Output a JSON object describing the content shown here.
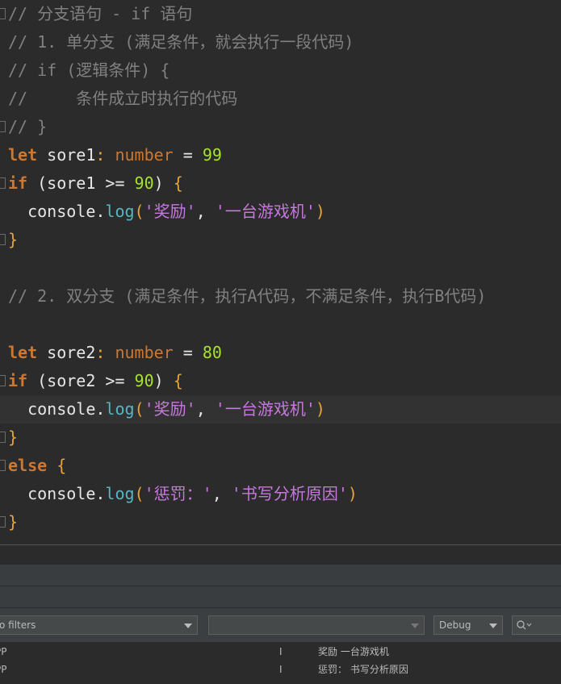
{
  "editor": {
    "lines": [
      {
        "segments": [
          {
            "c": "comment",
            "t": "// 分支语句 - if 语句"
          }
        ]
      },
      {
        "segments": [
          {
            "c": "comment",
            "t": "// 1. 单分支 (满足条件，就会执行一段代码)"
          }
        ]
      },
      {
        "segments": [
          {
            "c": "comment",
            "t": "// if (逻辑条件) {"
          }
        ]
      },
      {
        "segments": [
          {
            "c": "comment",
            "t": "//     条件成立时执行的代码"
          }
        ]
      },
      {
        "segments": [
          {
            "c": "comment",
            "t": "// }"
          }
        ]
      },
      {
        "segments": [
          {
            "c": "kw",
            "t": "let"
          },
          {
            "c": "plain",
            "t": " sore1"
          },
          {
            "c": "brace",
            "t": ": "
          },
          {
            "c": "type",
            "t": "number"
          },
          {
            "c": "plain",
            "t": " = "
          },
          {
            "c": "num",
            "t": "99"
          }
        ]
      },
      {
        "segments": [
          {
            "c": "kw",
            "t": "if"
          },
          {
            "c": "plain",
            "t": " (sore1 >= "
          },
          {
            "c": "num",
            "t": "90"
          },
          {
            "c": "plain",
            "t": ") "
          },
          {
            "c": "brace",
            "t": "{"
          }
        ]
      },
      {
        "segments": [
          {
            "c": "plain",
            "t": "  console."
          },
          {
            "c": "fn",
            "t": "log"
          },
          {
            "c": "brace",
            "t": "("
          },
          {
            "c": "str",
            "t": "'奖励'"
          },
          {
            "c": "plain",
            "t": ", "
          },
          {
            "c": "str",
            "t": "'一台游戏机'"
          },
          {
            "c": "brace",
            "t": ")"
          }
        ]
      },
      {
        "segments": [
          {
            "c": "brace",
            "t": "}"
          }
        ]
      },
      {
        "segments": []
      },
      {
        "segments": [
          {
            "c": "comment",
            "t": "// 2. 双分支 (满足条件，执行A代码，不满足条件，执行B代码)"
          }
        ]
      },
      {
        "segments": []
      },
      {
        "segments": [
          {
            "c": "kw",
            "t": "let"
          },
          {
            "c": "plain",
            "t": " sore2"
          },
          {
            "c": "brace",
            "t": ": "
          },
          {
            "c": "type",
            "t": "number"
          },
          {
            "c": "plain",
            "t": " = "
          },
          {
            "c": "num",
            "t": "80"
          }
        ]
      },
      {
        "segments": [
          {
            "c": "kw",
            "t": "if"
          },
          {
            "c": "plain",
            "t": " (sore2 >= "
          },
          {
            "c": "num",
            "t": "90"
          },
          {
            "c": "plain",
            "t": ") "
          },
          {
            "c": "brace",
            "t": "{"
          }
        ]
      },
      {
        "segments": [
          {
            "c": "plain",
            "t": "  console."
          },
          {
            "c": "fn",
            "t": "log"
          },
          {
            "c": "brace",
            "t": "("
          },
          {
            "c": "str",
            "t": "'奖励'"
          },
          {
            "c": "plain",
            "t": ", "
          },
          {
            "c": "str",
            "t": "'一台游戏机'"
          },
          {
            "c": "brace",
            "t": ")"
          }
        ]
      },
      {
        "segments": [
          {
            "c": "brace",
            "t": "}"
          }
        ]
      },
      {
        "segments": [
          {
            "c": "kw",
            "t": "else"
          },
          {
            "c": "plain",
            "t": " "
          },
          {
            "c": "brace",
            "t": "{"
          }
        ]
      },
      {
        "segments": [
          {
            "c": "plain",
            "t": "  console."
          },
          {
            "c": "fn",
            "t": "log"
          },
          {
            "c": "brace",
            "t": "("
          },
          {
            "c": "str",
            "t": "'惩罚：'"
          },
          {
            "c": "plain",
            "t": ", "
          },
          {
            "c": "str",
            "t": "'书写分析原因'"
          },
          {
            "c": "brace",
            "t": ")"
          }
        ]
      },
      {
        "segments": [
          {
            "c": "brace",
            "t": "}"
          }
        ]
      }
    ],
    "current_line": 14,
    "fold_markers_on": [
      0,
      4,
      6,
      8,
      13,
      15,
      16,
      18
    ]
  },
  "console": {
    "filter_combo": "o filters",
    "second_combo": "",
    "level_combo": "Debug",
    "search_icon": "search-icon",
    "rows": [
      {
        "tag": "PP",
        "level": "I",
        "msg": "奖励 一台游戏机"
      },
      {
        "tag": "PP",
        "level": "I",
        "msg": "惩罚： 书写分析原因"
      }
    ]
  },
  "colors": {
    "background": "#2b2b2b",
    "comment": "#808080",
    "keyword": "#cc7832",
    "number": "#a6e22e",
    "string": "#c678dd",
    "function": "#56b6c2",
    "brace": "#e5a536"
  }
}
